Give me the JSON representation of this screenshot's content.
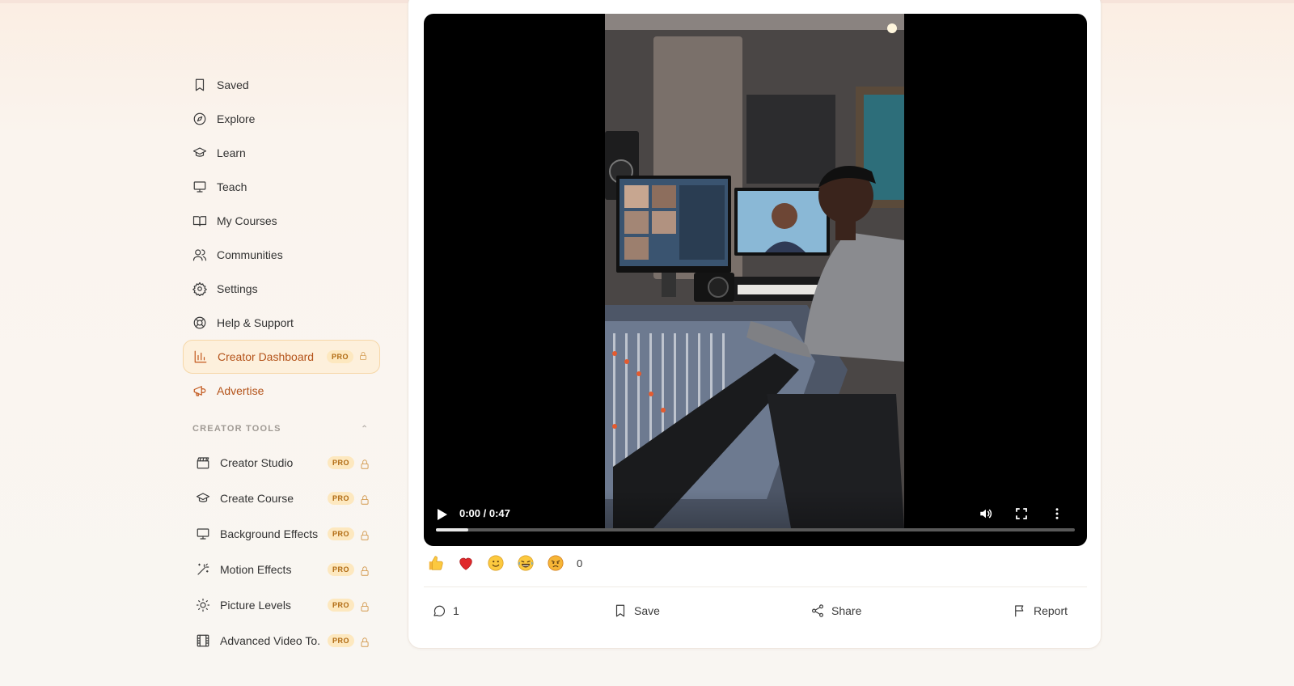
{
  "sidebar": {
    "items": [
      {
        "label": "Saved",
        "icon": "bookmark-icon"
      },
      {
        "label": "Explore",
        "icon": "compass-icon"
      },
      {
        "label": "Learn",
        "icon": "graduation-cap-icon"
      },
      {
        "label": "Teach",
        "icon": "presentation-icon"
      },
      {
        "label": "My Courses",
        "icon": "book-open-icon"
      },
      {
        "label": "Communities",
        "icon": "users-icon"
      },
      {
        "label": "Settings",
        "icon": "gear-icon"
      },
      {
        "label": "Help & Support",
        "icon": "lifebuoy-icon"
      },
      {
        "label": "Creator Dashboard",
        "icon": "bar-chart-icon",
        "badge": "PRO",
        "active": true
      },
      {
        "label": "Advertise",
        "icon": "megaphone-icon"
      }
    ],
    "section_title": "CREATOR TOOLS",
    "tools": [
      {
        "label": "Creator Studio",
        "icon": "clapperboard-icon",
        "badge": "PRO"
      },
      {
        "label": "Create Course",
        "icon": "graduation-cap-icon",
        "badge": "PRO"
      },
      {
        "label": "Background Effects",
        "icon": "presentation-icon",
        "badge": "PRO"
      },
      {
        "label": "Motion Effects",
        "icon": "magic-wand-icon",
        "badge": "PRO"
      },
      {
        "label": "Picture Levels",
        "icon": "sun-icon",
        "badge": "PRO"
      },
      {
        "label": "Advanced Video To...",
        "icon": "film-icon",
        "badge": "PRO"
      }
    ]
  },
  "video": {
    "time": "0:00 / 0:47",
    "progress": 0.05
  },
  "reactions": {
    "emojis": [
      "thumbs-up",
      "heart",
      "smile",
      "laughing",
      "angry"
    ],
    "count": "0"
  },
  "actions": {
    "comments": "1",
    "save": "Save",
    "share": "Share",
    "report": "Report"
  },
  "colors": {
    "accent": "#c2571c",
    "pro_badge_bg": "#fde8bf",
    "active_bg": "#fdf0dc"
  }
}
